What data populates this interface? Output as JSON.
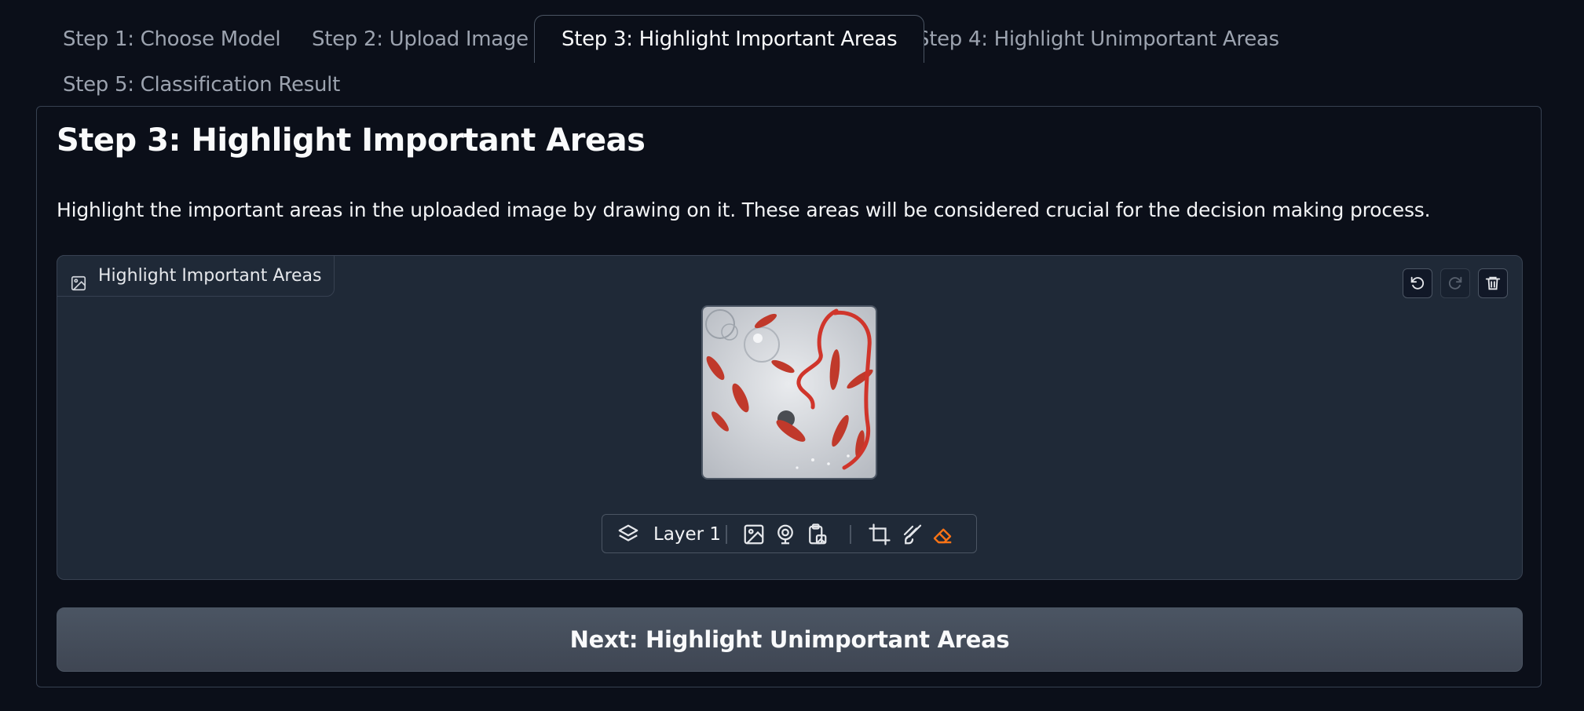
{
  "tabs": [
    {
      "label": "Step 1: Choose Model"
    },
    {
      "label": "Step 2: Upload Image"
    },
    {
      "label": "Step 3: Highlight Important Areas"
    },
    {
      "label": "Step 4: Highlight Unimportant Areas"
    },
    {
      "label": "Step 5: Classification Result"
    }
  ],
  "active_tab": 2,
  "panel": {
    "title": "Step 3: Highlight Important Areas",
    "description": "Highlight the important areas in the uploaded image by drawing on it. These areas will be considered crucial for the decision making process."
  },
  "editor": {
    "label": "Highlight Important Areas",
    "label_icon": "image-icon",
    "actions": [
      {
        "name": "undo-icon",
        "enabled": true
      },
      {
        "name": "redo-icon",
        "enabled": false
      },
      {
        "name": "trash-icon",
        "enabled": true
      }
    ],
    "toolbar": {
      "layer_label": "Layer 1",
      "tools": [
        "layers-icon",
        "image-upload-icon",
        "webcam-icon",
        "clipboard-paste-icon",
        "crop-icon",
        "brush-icon",
        "eraser-icon"
      ],
      "active_tool": "eraser-icon"
    }
  },
  "next_button": "Next: Highlight Unimportant Areas",
  "colors": {
    "background": "#0b0f19",
    "panel": "#1f2937",
    "border": "#374151",
    "accent": "#f97316",
    "brush": "#d0352b"
  }
}
